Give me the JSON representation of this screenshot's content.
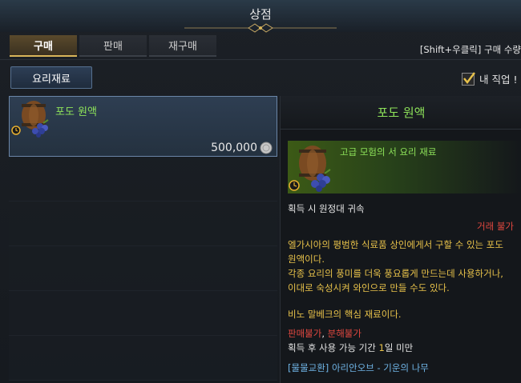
{
  "window": {
    "title": "상점"
  },
  "tabs": [
    {
      "label": "구매",
      "active": true
    },
    {
      "label": "판매",
      "active": false
    },
    {
      "label": "재구매",
      "active": false
    }
  ],
  "hint": "[Shift+우클릭] 구매 수량",
  "category_button": "요리재료",
  "job_filter": {
    "label": "내 직업 !",
    "checked": true
  },
  "item": {
    "name": "포도 원액",
    "price": "500,000",
    "icon": "wine-barrel-grapes-icon",
    "currency_icon": "silver-coin-icon"
  },
  "detail": {
    "title": "포도 원액",
    "subtitle": "고급 모험의 서 요리 재료",
    "bind": "획득 시 원정대 귀속",
    "trade": "거래 불가",
    "desc_lines": [
      "엘가시아의 평범한 식료품 상인에게서 구할 수 있는 포도",
      "원액이다.",
      "각종 요리의 풍미를 더욱 풍요롭게 만드는데 사용하거나,",
      "이대로 숙성시켜 와인으로 만들 수도 있다."
    ],
    "note": "비노 말베크의 핵심 재료이다.",
    "no_sell": "판매불가",
    "comma": ", ",
    "no_dismantle": "분해불가",
    "period_prefix": "획득 후 사용 가능 기간 ",
    "period_num": "1",
    "period_suffix": "일 미만",
    "exchange": "[물물교환] 아리안오브 - 기운의 나무"
  },
  "colors": {
    "green": "#8ee35a",
    "red": "#e0473f",
    "gold": "#e8c24a",
    "blue": "#6fb4e6",
    "accent": "#d9b55a"
  }
}
